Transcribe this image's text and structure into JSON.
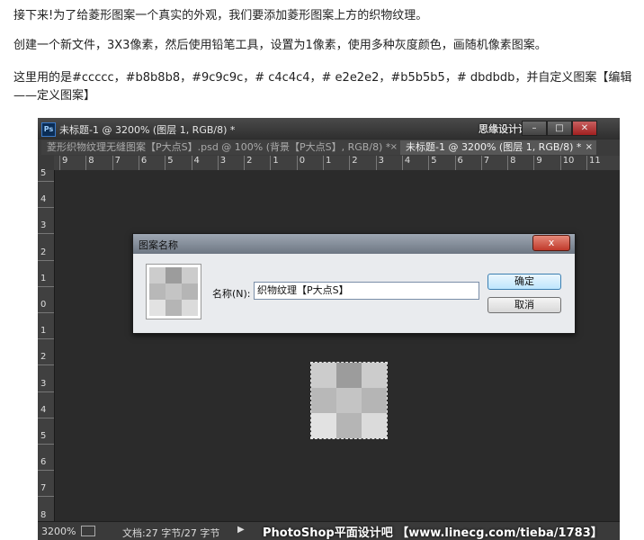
{
  "article": {
    "p1": "接下来!为了给菱形图案一个真实的外观，我们要添加菱形图案上方的织物纹理。",
    "p2": "创建一个新文件，3X3像素，然后使用铅笔工具，设置为1像素，使用多种灰度颜色，画随机像素图案。",
    "p3a": "这里用的是#ccccc，#b8b8b8，#9c9c9c，# c4c4c4，# e2e2e2，#b5b5b5，# dbdbdb，并自定义图案【编辑",
    "p3b": "——定义图案】"
  },
  "window": {
    "logo": "Ps",
    "title": "未标题-1 @ 3200% (图层 1, RGB/8) *",
    "watermark_top": "思缘设计论坛",
    "min_icon": "minimize-icon",
    "max_icon": "maximize-icon",
    "close_icon": "close-icon"
  },
  "tabs": [
    {
      "label": "菱形织物纹理无缝图案【P大点S】.psd @ 100% (背景【P大点S】, RGB/8) *",
      "close": "×"
    },
    {
      "label": "未标题-1 @ 3200% (图层 1, RGB/8) *",
      "close": "×"
    }
  ],
  "ruler": {
    "h_labels": [
      "9",
      "8",
      "7",
      "6",
      "5",
      "4",
      "3",
      "2",
      "1",
      "0",
      "1",
      "2",
      "3",
      "4",
      "5",
      "6",
      "7",
      "8",
      "9",
      "10",
      "11"
    ],
    "v_labels": [
      "5",
      "4",
      "3",
      "2",
      "1",
      "0",
      "1",
      "2",
      "3",
      "4",
      "5",
      "6",
      "7",
      "8"
    ]
  },
  "pattern_colors": [
    "#cccccc",
    "#9c9c9c",
    "#cccccc",
    "#b8b8b8",
    "#c4c4c4",
    "#b5b5b5",
    "#e2e2e2",
    "#b5b5b5",
    "#dbdbdb"
  ],
  "dialog": {
    "title": "图案名称",
    "close_label": "x",
    "name_label": "名称(N):",
    "name_value": "织物纹理【P大点S】",
    "ok_label": "确定",
    "cancel_label": "取消"
  },
  "status": {
    "zoom": "3200%",
    "doc": "文档:27 字节/27 字节",
    "arrow": "▶",
    "watermark": "PhotoShop平面设计吧 【www.linecg.com/tieba/1783】"
  }
}
